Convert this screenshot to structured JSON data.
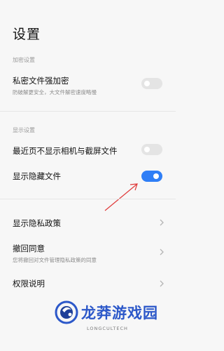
{
  "header": {
    "title": "设置"
  },
  "encryption": {
    "section_label": "加密设置",
    "private_file": {
      "title": "私密文件强加密",
      "subtitle": "防破解更安全，大文件解密速度略慢",
      "enabled": false
    }
  },
  "display": {
    "section_label": "显示设置",
    "hide_recent": {
      "title": "最近页不显示相机与截屏文件",
      "enabled": false
    },
    "show_hidden": {
      "title": "显示隐藏文件",
      "enabled": true
    }
  },
  "links": {
    "privacy_policy": {
      "title": "显示隐私政策"
    },
    "revoke_consent": {
      "title": "撤回同意",
      "subtitle": "您将撤回对文件管理隐私政策的同意"
    },
    "permissions": {
      "title": "权限说明"
    }
  },
  "watermark": {
    "name": "龙莽游戏园",
    "url": "LONGCULTECH"
  },
  "colors": {
    "accent": "#2f7ef6",
    "annotation": "#e03a3a",
    "brand": "#2c58c9"
  }
}
